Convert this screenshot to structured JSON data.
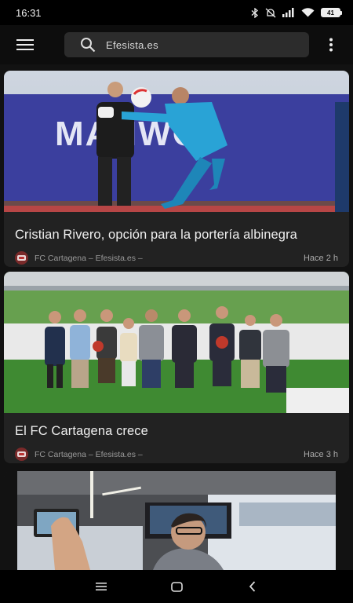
{
  "status_bar": {
    "time": "16:31",
    "battery_level": "41",
    "icons": [
      "bluetooth-icon",
      "mute-icon",
      "signal-icon",
      "wifi-icon",
      "battery-icon"
    ]
  },
  "toolbar": {
    "menu_icon": "hamburger-menu-icon",
    "search_icon": "search-icon",
    "search_text": "Efesista.es",
    "more_icon": "more-vertical-icon"
  },
  "articles": [
    {
      "title": "Cristian Rivero, opción para la portería albinegra",
      "source": "FC Cartagena – Efesista.es –",
      "time": "Hace 2 h",
      "image_text": "MAHWO"
    },
    {
      "title": "El FC Cartagena crece",
      "source": "FC Cartagena – Efesista.es –",
      "time": "Hace 3 h"
    },
    {
      "title": "",
      "source": "",
      "time": ""
    }
  ],
  "nav_bar": {
    "icons": [
      "recents-icon",
      "home-icon",
      "back-icon"
    ]
  },
  "colors": {
    "background": "#121212",
    "card": "#222222",
    "search_box": "#2c2c2c"
  }
}
